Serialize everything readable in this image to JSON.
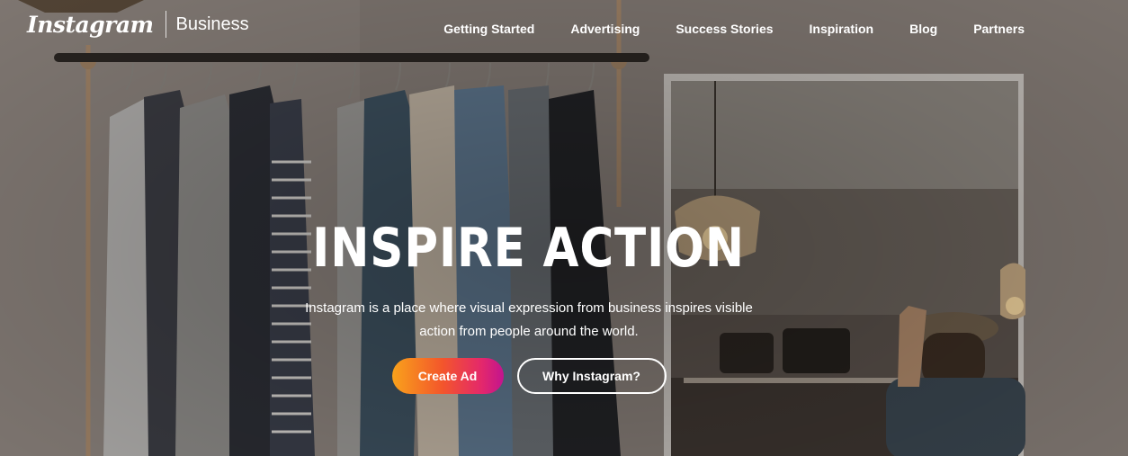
{
  "brand": {
    "wordmark": "Instagram",
    "sub": "Business"
  },
  "nav": {
    "items": [
      {
        "label": "Getting Started"
      },
      {
        "label": "Advertising"
      },
      {
        "label": "Success Stories"
      },
      {
        "label": "Inspiration"
      },
      {
        "label": "Blog"
      },
      {
        "label": "Partners"
      }
    ]
  },
  "hero": {
    "headline": "INSPIRE ACTION",
    "subtext": "Instagram is a place where visual expression from business inspires visible action from people around the world.",
    "primary_button": "Create Ad",
    "secondary_button": "Why Instagram?"
  },
  "colors": {
    "button_gradient": [
      "#f9a21b",
      "#f3562b",
      "#e4286b",
      "#c2148f"
    ],
    "text": "#ffffff"
  }
}
